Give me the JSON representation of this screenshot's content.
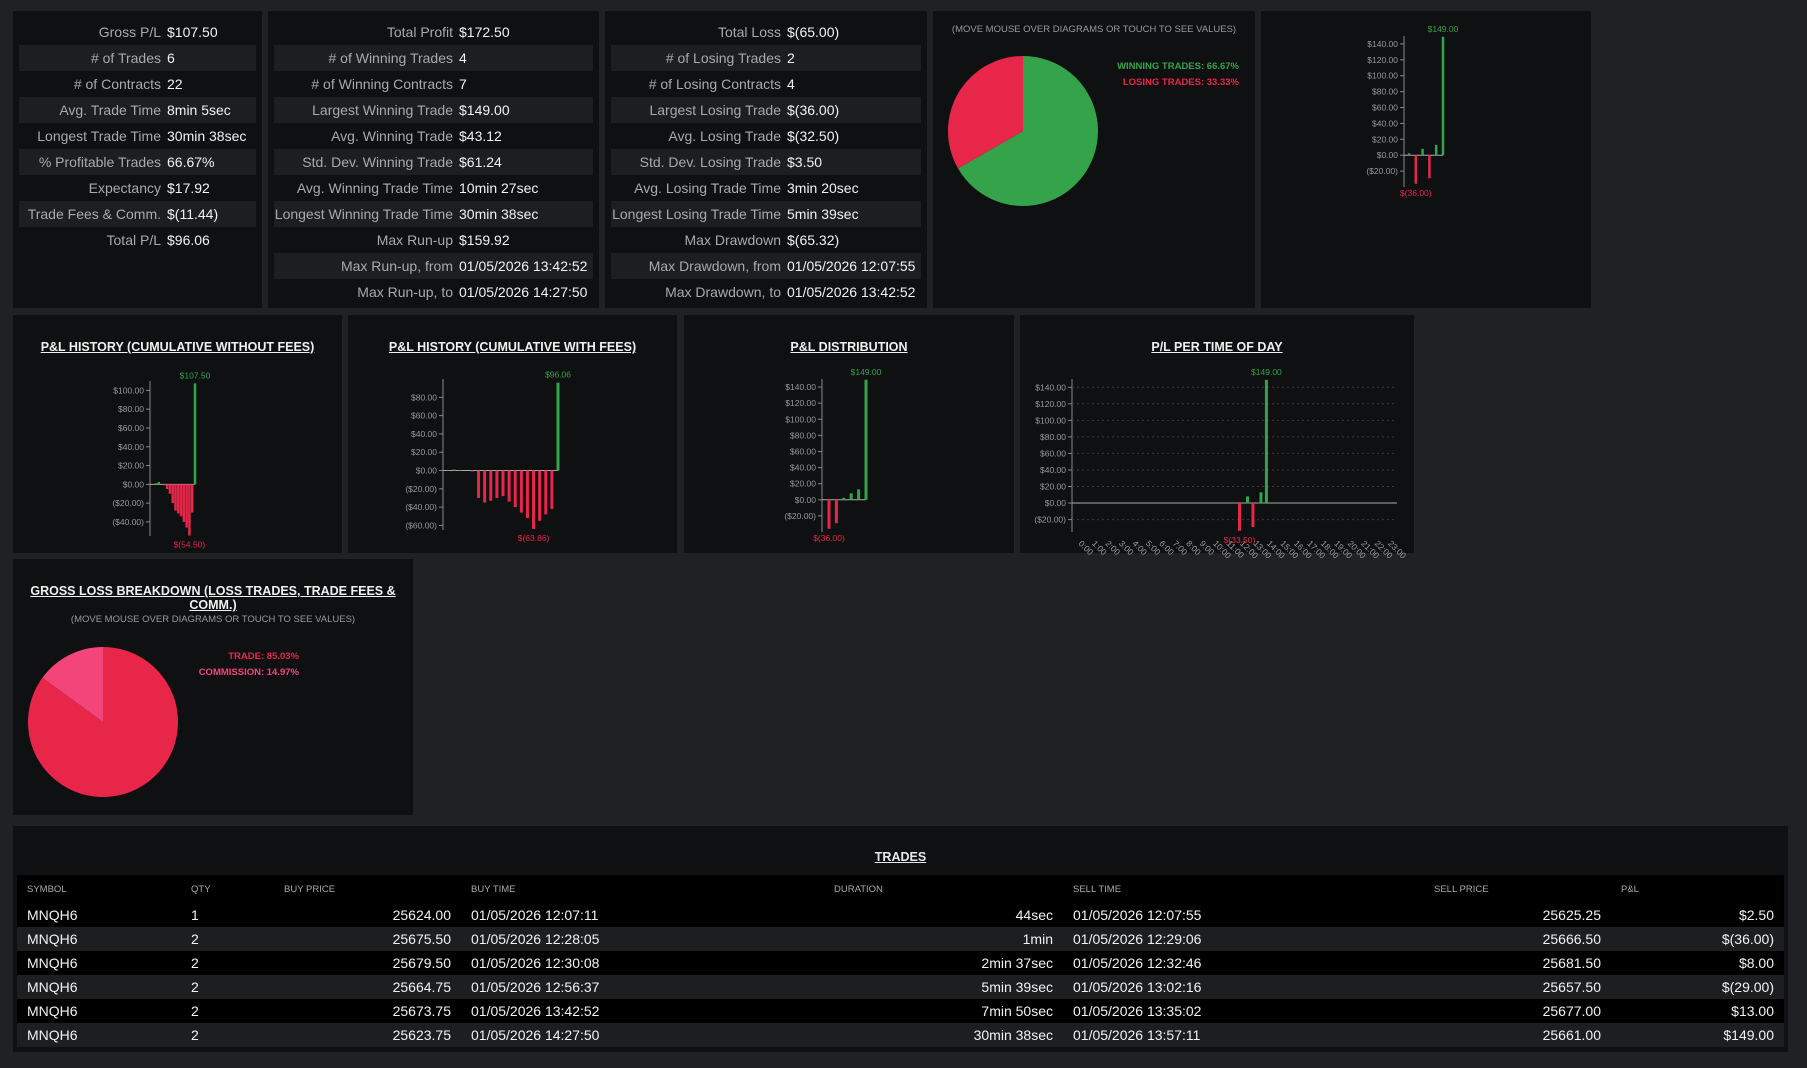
{
  "summary": [
    {
      "label": "Gross P/L",
      "value": "$107.50"
    },
    {
      "label": "# of Trades",
      "value": "6"
    },
    {
      "label": "# of Contracts",
      "value": "22"
    },
    {
      "label": "Avg. Trade Time",
      "value": "8min 5sec"
    },
    {
      "label": "Longest Trade Time",
      "value": "30min 38sec"
    },
    {
      "label": "% Profitable Trades",
      "value": "66.67%"
    },
    {
      "label": "Expectancy",
      "value": "$17.92"
    },
    {
      "label": "Trade Fees & Comm.",
      "value": "$(11.44)"
    },
    {
      "label": "Total P/L",
      "value": "$96.06"
    }
  ],
  "winning": [
    {
      "label": "Total Profit",
      "value": "$172.50"
    },
    {
      "label": "# of Winning Trades",
      "value": "4"
    },
    {
      "label": "# of Winning Contracts",
      "value": "7"
    },
    {
      "label": "Largest Winning Trade",
      "value": "$149.00"
    },
    {
      "label": "Avg. Winning Trade",
      "value": "$43.12"
    },
    {
      "label": "Std. Dev. Winning Trade",
      "value": "$61.24"
    },
    {
      "label": "Avg. Winning Trade Time",
      "value": "10min 27sec"
    },
    {
      "label": "Longest Winning Trade Time",
      "value": "30min 38sec"
    },
    {
      "label": "Max Run-up",
      "value": "$159.92"
    },
    {
      "label": "Max Run-up, from",
      "value": "01/05/2026 13:42:52"
    },
    {
      "label": "Max Run-up, to",
      "value": "01/05/2026 14:27:50"
    }
  ],
  "losing": [
    {
      "label": "Total Loss",
      "value": "$(65.00)"
    },
    {
      "label": "# of Losing Trades",
      "value": "2"
    },
    {
      "label": "# of Losing Contracts",
      "value": "4"
    },
    {
      "label": "Largest Losing Trade",
      "value": "$(36.00)"
    },
    {
      "label": "Avg. Losing Trade",
      "value": "$(32.50)"
    },
    {
      "label": "Std. Dev. Losing Trade",
      "value": "$3.50"
    },
    {
      "label": "Avg. Losing Trade Time",
      "value": "3min 20sec"
    },
    {
      "label": "Longest Losing Trade Time",
      "value": "5min 39sec"
    },
    {
      "label": "Max Drawdown",
      "value": "$(65.32)"
    },
    {
      "label": "Max Drawdown, from",
      "value": "01/05/2026 12:07:55"
    },
    {
      "label": "Max Drawdown, to",
      "value": "01/05/2026 13:42:52"
    }
  ],
  "hint_text": "(MOVE MOUSE OVER DIAGRAMS OR TOUCH TO SEE VALUES)",
  "colors": {
    "win": "#34a34a",
    "loss": "#e8264a",
    "commission": "#f4457a",
    "panel": "#0f1011",
    "bg": "#202124"
  },
  "chart_data": [
    {
      "id": "win-loss-pie",
      "type": "pie",
      "labels": [
        "WINNING TRADES: 66.67%",
        "LOSING TRADES: 33.33%"
      ],
      "values": [
        66.67,
        33.33
      ]
    },
    {
      "id": "trade-pl-mini",
      "type": "bar",
      "ylim": [
        -40,
        150
      ],
      "yticks": [
        "$140.00",
        "$120.00",
        "$100.00",
        "$80.00",
        "$60.00",
        "$40.00",
        "$20.00",
        "$0.00",
        "($20.00)"
      ],
      "yvals": [
        140,
        120,
        100,
        80,
        60,
        40,
        20,
        0,
        -20
      ],
      "values": [
        2.5,
        -36,
        8,
        -29,
        13,
        149
      ],
      "max_label": "$149.00",
      "min_label": "$(36.00)"
    },
    {
      "id": "pl-history-no-fees",
      "type": "bar",
      "title": "P&L HISTORY (CUMULATIVE WITHOUT FEES)",
      "ylim": [
        -55,
        110
      ],
      "yticks": [
        "$100.00",
        "$80.00",
        "$60.00",
        "$40.00",
        "$20.00",
        "$0.00",
        "($20.00)",
        "($40.00)"
      ],
      "yvals": [
        100,
        80,
        60,
        40,
        20,
        0,
        -20,
        -40
      ],
      "values": [
        1,
        2.5,
        0,
        -1,
        -5,
        -10,
        -20,
        -28,
        -31,
        -34,
        -40,
        -46,
        -54.5,
        -30,
        107.5
      ],
      "max_label": "$107.50",
      "min_label": "$(54.50)"
    },
    {
      "id": "pl-history-with-fees",
      "type": "bar",
      "title": "P&L HISTORY (CUMULATIVE WITH FEES)",
      "ylim": [
        -65,
        100
      ],
      "yticks": [
        "$80.00",
        "$60.00",
        "$40.00",
        "$20.00",
        "$0.00",
        "($20.00)",
        "($40.00)",
        "($60.00)"
      ],
      "yvals": [
        80,
        60,
        40,
        20,
        0,
        -20,
        -40,
        -60
      ],
      "values": [
        0.5,
        1,
        0.5,
        0,
        -1,
        -30,
        -35,
        -33,
        -30,
        -28,
        -34,
        -40,
        -46,
        -52,
        -63.86,
        -55,
        -48,
        -42,
        96.06
      ],
      "max_label": "$96.06",
      "min_label": "$(63.86)"
    },
    {
      "id": "pl-distribution",
      "type": "bar",
      "title": "P&L DISTRIBUTION",
      "ylim": [
        -40,
        150
      ],
      "yticks": [
        "$140.00",
        "$120.00",
        "$100.00",
        "$80.00",
        "$60.00",
        "$40.00",
        "$20.00",
        "$0.00",
        "($20.00)"
      ],
      "yvals": [
        140,
        120,
        100,
        80,
        60,
        40,
        20,
        0,
        -20
      ],
      "values": [
        -36,
        -29,
        2.5,
        8,
        13,
        149
      ],
      "max_label": "$149.00",
      "min_label": "$(36.00)"
    },
    {
      "id": "pl-time-of-day",
      "type": "bar",
      "title": "P/L PER TIME OF DAY",
      "ylim": [
        -35,
        150
      ],
      "yticks": [
        "$140.00",
        "$120.00",
        "$100.00",
        "$80.00",
        "$60.00",
        "$40.00",
        "$20.00",
        "$0.00",
        "($20.00)"
      ],
      "yvals": [
        140,
        120,
        100,
        80,
        60,
        40,
        20,
        0,
        -20
      ],
      "categories": [
        "0:00",
        "1:00",
        "2:00",
        "3:00",
        "4:00",
        "5:00",
        "6:00",
        "7:00",
        "8:00",
        "9:00",
        "10:00",
        "11:00",
        "12:00",
        "13:00",
        "14:00",
        "15:00",
        "16:00",
        "17:00",
        "18:00",
        "19:00",
        "20:00",
        "21:00",
        "22:00",
        "23:00"
      ],
      "series": [
        {
          "hour": 12,
          "values": [
            -33.5,
            8
          ]
        },
        {
          "hour": 13,
          "values": [
            -29,
            13
          ]
        },
        {
          "hour": 14,
          "values": [
            149
          ]
        }
      ],
      "max_label": "$149.00",
      "min_label": "$(33.50)"
    },
    {
      "id": "gross-loss-pie",
      "type": "pie",
      "title": "GROSS LOSS BREAKDOWN (LOSS TRADES, TRADE FEES & COMM.)",
      "labels": [
        "TRADE: 85.03%",
        "COMMISSION: 14.97%"
      ],
      "values": [
        85.03,
        14.97
      ]
    }
  ],
  "trades": {
    "title": "TRADES",
    "columns": [
      "SYMBOL",
      "QTY",
      "BUY PRICE",
      "BUY TIME",
      "DURATION",
      "SELL TIME",
      "SELL PRICE",
      "P&L"
    ],
    "rows": [
      [
        "MNQH6",
        "1",
        "25624.00",
        "01/05/2026 12:07:11",
        "44sec",
        "01/05/2026 12:07:55",
        "25625.25",
        "$2.50"
      ],
      [
        "MNQH6",
        "2",
        "25675.50",
        "01/05/2026 12:28:05",
        "1min",
        "01/05/2026 12:29:06",
        "25666.50",
        "$(36.00)"
      ],
      [
        "MNQH6",
        "2",
        "25679.50",
        "01/05/2026 12:30:08",
        "2min 37sec",
        "01/05/2026 12:32:46",
        "25681.50",
        "$8.00"
      ],
      [
        "MNQH6",
        "2",
        "25664.75",
        "01/05/2026 12:56:37",
        "5min 39sec",
        "01/05/2026 13:02:16",
        "25657.50",
        "$(29.00)"
      ],
      [
        "MNQH6",
        "2",
        "25673.75",
        "01/05/2026 13:42:52",
        "7min 50sec",
        "01/05/2026 13:35:02",
        "25677.00",
        "$13.00"
      ],
      [
        "MNQH6",
        "2",
        "25623.75",
        "01/05/2026 14:27:50",
        "30min 38sec",
        "01/05/2026 13:57:11",
        "25661.00",
        "$149.00"
      ]
    ]
  }
}
